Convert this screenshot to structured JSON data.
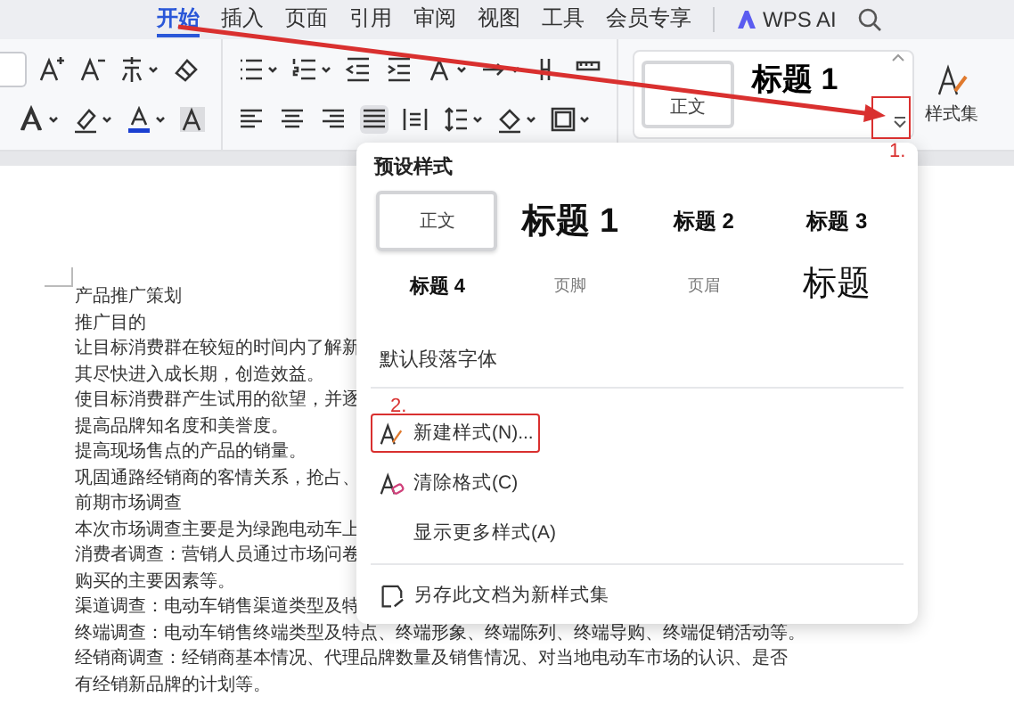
{
  "tabs": [
    {
      "label": "开始",
      "selected": true
    },
    {
      "label": "插入",
      "selected": false
    },
    {
      "label": "页面",
      "selected": false
    },
    {
      "label": "引用",
      "selected": false
    },
    {
      "label": "审阅",
      "selected": false
    },
    {
      "label": "视图",
      "selected": false
    },
    {
      "label": "工具",
      "selected": false
    },
    {
      "label": "会员专享",
      "selected": false
    }
  ],
  "ai_button": {
    "label": "WPS AI"
  },
  "ribbon": {
    "alignment": [
      {
        "kind": "left",
        "selected": false
      },
      {
        "kind": "center",
        "selected": false
      },
      {
        "kind": "right",
        "selected": false
      },
      {
        "kind": "justify",
        "selected": true
      },
      {
        "kind": "distributed",
        "selected": false
      }
    ],
    "style_gallery": [
      {
        "label": "正文",
        "selected": true
      },
      {
        "label": "标题 1",
        "selected": false
      }
    ],
    "style_set": {
      "label": "样式集"
    }
  },
  "document": {
    "lines": [
      "产品推广策划",
      "推广目的",
      "让目标消费群在较短的时间内了解新",
      "其尽快进入成长期，创造效益。",
      "使目标消费群产生试用的欲望，并逐",
      "提高品牌知名度和美誉度。",
      "提高现场售点的产品的销量。",
      "巩固通路经销商的客情关系，抢占、",
      "前期市场调查",
      "本次市场调查主要是为绿跑电动车上",
      "消费者调查：营销人员通过市场问卷",
      "购买的主要因素等。",
      "渠道调查：电动车销售渠道类型及特",
      "终端调查：电动车销售终端类型及特点、终端形象、终端陈列、终端导购、终端促销活动等。",
      "经销商调查：经销商基本情况、代理品牌数量及销售情况、对当地电动车市场的认识、是否",
      "有经销新品牌的计划等。"
    ]
  },
  "style_panel": {
    "title": "预设样式",
    "styles": [
      {
        "label": "正文",
        "kind": "body",
        "selected": true
      },
      {
        "label": "标题 1",
        "kind": "heading1",
        "selected": false
      },
      {
        "label": "标题 2",
        "kind": "heading2",
        "selected": false
      },
      {
        "label": "标题 3",
        "kind": "heading3",
        "selected": false
      },
      {
        "label": "标题 4",
        "kind": "heading4",
        "selected": false
      },
      {
        "label": "页脚",
        "kind": "footer",
        "selected": false
      },
      {
        "label": "页眉",
        "kind": "header",
        "selected": false
      },
      {
        "label": "标题",
        "kind": "title",
        "selected": false
      }
    ],
    "default_font": "默认段落字体",
    "actions": [
      {
        "label": "新建样式(N)...",
        "kind": "new",
        "highlighted": true
      },
      {
        "label": "清除格式(C)",
        "kind": "clear",
        "highlighted": false
      },
      {
        "label": "显示更多样式(A)",
        "kind": "more",
        "highlighted": false
      },
      {
        "label": "另存此文档为新样式集",
        "kind": "save",
        "highlighted": false
      }
    ]
  },
  "annotations": [
    {
      "label": "1."
    },
    {
      "label": "2."
    }
  ]
}
